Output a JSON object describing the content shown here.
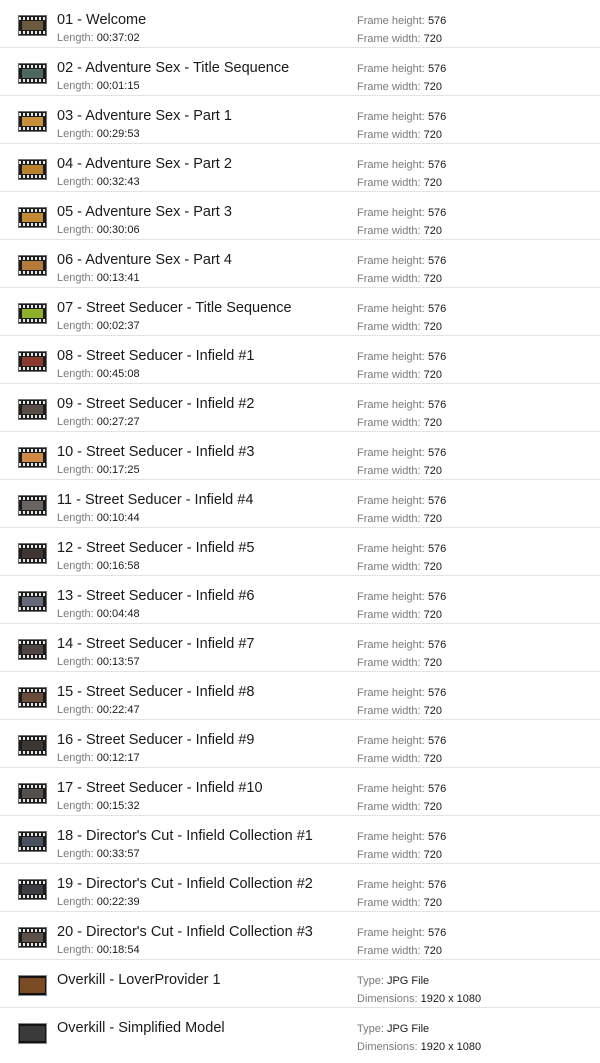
{
  "labels": {
    "length": "Length:",
    "frame_height": "Frame height:",
    "frame_width": "Frame width:",
    "type": "Type:",
    "dimensions": "Dimensions:"
  },
  "colors": {
    "row_divider": "#e3e3e3",
    "label_text": "#7a7a7a",
    "value_text": "#1a1a1a"
  },
  "files": [
    {
      "kind": "video",
      "icon": "video-thumbnail-icon",
      "thumb_color": "#6b5a3e",
      "name": "01 - Welcome",
      "length": "00:37:02",
      "frame_height": "576",
      "frame_width": "720"
    },
    {
      "kind": "video",
      "icon": "video-thumbnail-icon",
      "thumb_color": "#4d6860",
      "name": "02 - Adventure Sex - Title Sequence",
      "length": "00:01:15",
      "frame_height": "576",
      "frame_width": "720"
    },
    {
      "kind": "video",
      "icon": "video-thumbnail-icon",
      "thumb_color": "#c8903a",
      "name": "03 - Adventure Sex - Part 1",
      "length": "00:29:53",
      "frame_height": "576",
      "frame_width": "720"
    },
    {
      "kind": "video",
      "icon": "video-thumbnail-icon",
      "thumb_color": "#b9822f",
      "name": "04 - Adventure Sex - Part 2",
      "length": "00:32:43",
      "frame_height": "576",
      "frame_width": "720"
    },
    {
      "kind": "video",
      "icon": "video-thumbnail-icon",
      "thumb_color": "#c28a34",
      "name": "05 - Adventure Sex - Part 3",
      "length": "00:30:06",
      "frame_height": "576",
      "frame_width": "720"
    },
    {
      "kind": "video",
      "icon": "video-thumbnail-icon",
      "thumb_color": "#b37a3a",
      "name": "06 - Adventure Sex - Part 4",
      "length": "00:13:41",
      "frame_height": "576",
      "frame_width": "720"
    },
    {
      "kind": "video",
      "icon": "video-thumbnail-icon",
      "thumb_color": "#8fb02c",
      "name": "07 - Street Seducer - Title Sequence",
      "length": "00:02:37",
      "frame_height": "576",
      "frame_width": "720"
    },
    {
      "kind": "video",
      "icon": "video-thumbnail-icon",
      "thumb_color": "#8a3b2e",
      "name": "08 - Street Seducer - Infield #1",
      "length": "00:45:08",
      "frame_height": "576",
      "frame_width": "720"
    },
    {
      "kind": "video",
      "icon": "video-thumbnail-icon",
      "thumb_color": "#5a4d48",
      "name": "09 - Street Seducer - Infield #2",
      "length": "00:27:27",
      "frame_height": "576",
      "frame_width": "720"
    },
    {
      "kind": "video",
      "icon": "video-thumbnail-icon",
      "thumb_color": "#d08a45",
      "name": "10 - Street Seducer - Infield #3",
      "length": "00:17:25",
      "frame_height": "576",
      "frame_width": "720"
    },
    {
      "kind": "video",
      "icon": "video-thumbnail-icon",
      "thumb_color": "#6c6460",
      "name": "11 - Street Seducer - Infield #4",
      "length": "00:10:44",
      "frame_height": "576",
      "frame_width": "720"
    },
    {
      "kind": "video",
      "icon": "video-thumbnail-icon",
      "thumb_color": "#3f3530",
      "name": "12 - Street Seducer - Infield #5",
      "length": "00:16:58",
      "frame_height": "576",
      "frame_width": "720"
    },
    {
      "kind": "video",
      "icon": "video-thumbnail-icon",
      "thumb_color": "#646a78",
      "name": "13 - Street Seducer - Infield #6",
      "length": "00:04:48",
      "frame_height": "576",
      "frame_width": "720"
    },
    {
      "kind": "video",
      "icon": "video-thumbnail-icon",
      "thumb_color": "#4f4540",
      "name": "14 - Street Seducer - Infield #7",
      "length": "00:13:57",
      "frame_height": "576",
      "frame_width": "720"
    },
    {
      "kind": "video",
      "icon": "video-thumbnail-icon",
      "thumb_color": "#6a4a38",
      "name": "15 - Street Seducer - Infield #8",
      "length": "00:22:47",
      "frame_height": "576",
      "frame_width": "720"
    },
    {
      "kind": "video",
      "icon": "video-thumbnail-icon",
      "thumb_color": "#3d3530",
      "name": "16 - Street Seducer - Infield #9",
      "length": "00:12:17",
      "frame_height": "576",
      "frame_width": "720"
    },
    {
      "kind": "video",
      "icon": "video-thumbnail-icon",
      "thumb_color": "#55504c",
      "name": "17 - Street Seducer - Infield #10",
      "length": "00:15:32",
      "frame_height": "576",
      "frame_width": "720"
    },
    {
      "kind": "video",
      "icon": "video-thumbnail-icon",
      "thumb_color": "#4a5260",
      "name": "18 - Director's Cut - Infield Collection #1",
      "length": "00:33:57",
      "frame_height": "576",
      "frame_width": "720"
    },
    {
      "kind": "video",
      "icon": "video-thumbnail-icon",
      "thumb_color": "#3c3c44",
      "name": "19 - Director's Cut - Infield Collection #2",
      "length": "00:22:39",
      "frame_height": "576",
      "frame_width": "720"
    },
    {
      "kind": "video",
      "icon": "video-thumbnail-icon",
      "thumb_color": "#5a5048",
      "name": "20 - Director's Cut - Infield Collection #3",
      "length": "00:18:54",
      "frame_height": "576",
      "frame_width": "720"
    },
    {
      "kind": "image",
      "icon": "image-thumbnail-icon",
      "thumb_color": "#7a4a22",
      "name": "Overkill - LoverProvider 1",
      "type": "JPG File",
      "dimensions": "1920 x 1080"
    },
    {
      "kind": "image",
      "icon": "image-thumbnail-icon",
      "thumb_color": "#3a3a3a",
      "name": "Overkill - Simplified Model",
      "type": "JPG File",
      "dimensions": "1920 x 1080"
    }
  ]
}
